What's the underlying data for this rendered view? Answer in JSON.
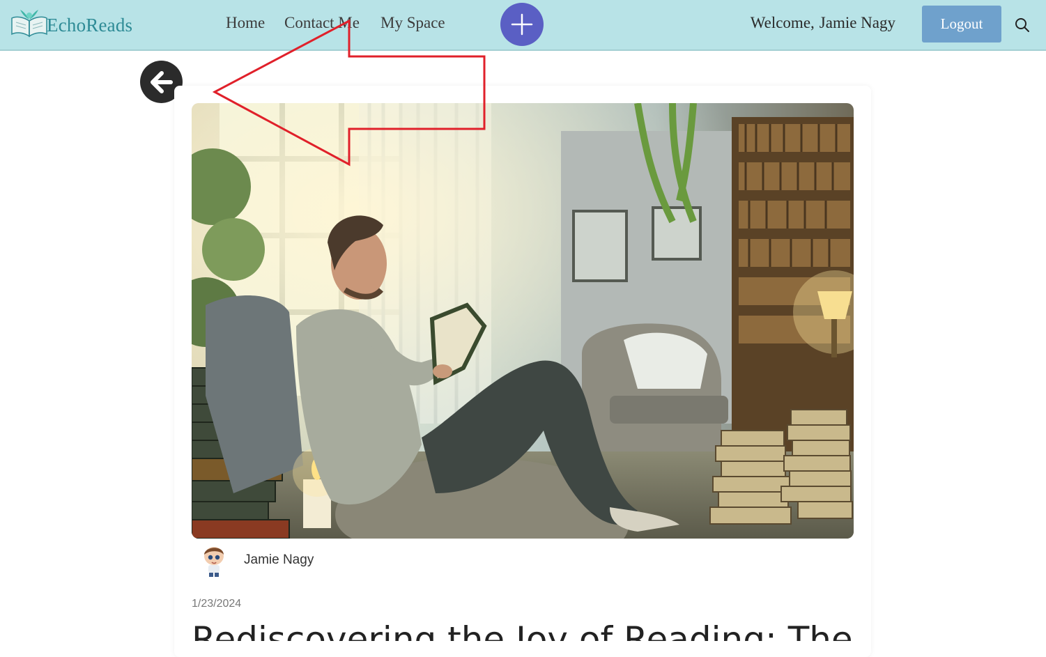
{
  "app": {
    "name": "EchoReads"
  },
  "nav": {
    "links": [
      {
        "label": "Home"
      },
      {
        "label": "Contact Me"
      },
      {
        "label": "My Space"
      }
    ],
    "add_icon": "plus-icon",
    "welcome_prefix": "Welcome,",
    "user_name": "Jamie Nagy",
    "logout_label": "Logout",
    "search_icon": "search-icon"
  },
  "back_icon": "arrow-left-icon",
  "post": {
    "author": "Jamie Nagy",
    "date": "1/23/2024",
    "title": "Rediscovering the Joy of Reading: The"
  },
  "colors": {
    "navbar_bg": "#b8e3e7",
    "brand_text": "#2e8b96",
    "add_button": "#5a5fc4",
    "logout_button": "#6fa1cc",
    "back_button": "#2b2b2b",
    "annotation_arrow": "#e0202a"
  }
}
